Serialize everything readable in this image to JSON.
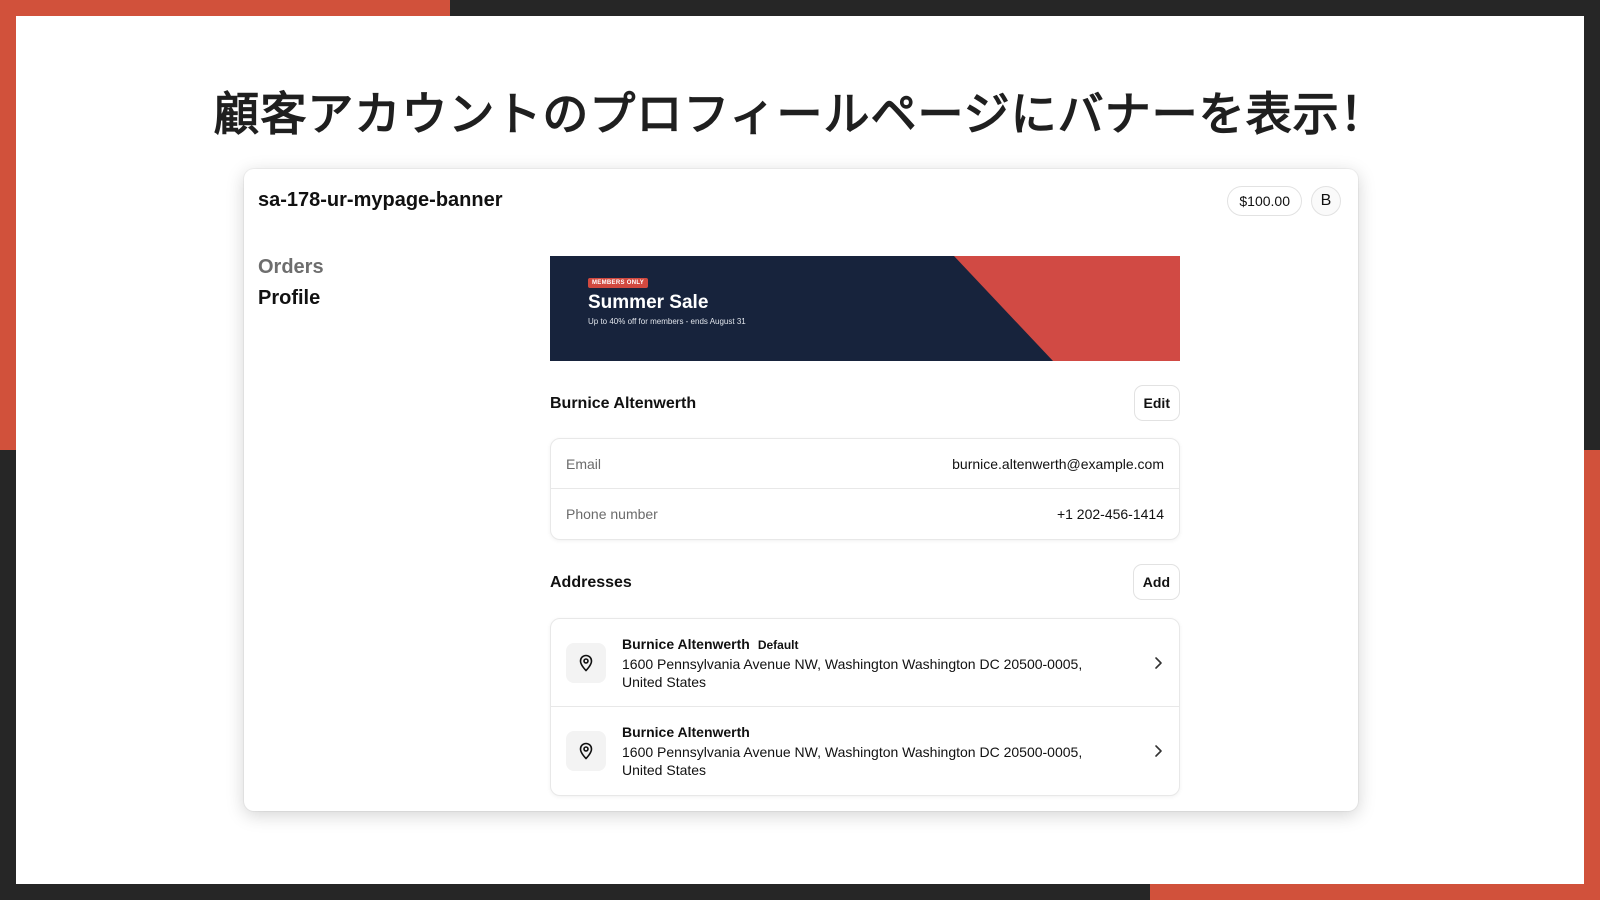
{
  "slide": {
    "title": "顧客アカウントのプロフィールページにバナーを表示！"
  },
  "app": {
    "store_name": "sa-178-ur-mypage-banner",
    "balance": "$100.00",
    "avatar_initial": "B"
  },
  "sidebar": {
    "items": [
      {
        "label": "Orders",
        "active": false
      },
      {
        "label": "Profile",
        "active": true
      }
    ]
  },
  "banner": {
    "badge": "MEMBERS ONLY",
    "title": "Summer Sale",
    "subtitle": "Up to 40% off for members - ends August 31",
    "colors": {
      "background": "#17233C",
      "accent": "#D14A44"
    }
  },
  "profile": {
    "name": "Burnice Altenwerth",
    "edit_label": "Edit",
    "fields": [
      {
        "label": "Email",
        "value": "burnice.altenwerth@example.com"
      },
      {
        "label": "Phone number",
        "value": "+1 202-456-1414"
      }
    ]
  },
  "addresses": {
    "title": "Addresses",
    "add_label": "Add",
    "items": [
      {
        "name": "Burnice Altenwerth",
        "badge": "Default",
        "line1": "1600 Pennsylvania Avenue NW, Washington Washington DC 20500-0005,",
        "line2": "United States"
      },
      {
        "name": "Burnice Altenwerth",
        "badge": "",
        "line1": "1600 Pennsylvania Avenue NW, Washington Washington DC 20500-0005,",
        "line2": "United States"
      }
    ]
  },
  "icons": {
    "address": "map-pin-icon",
    "row_action": "chevron-right-icon"
  },
  "theme": {
    "frame": "#262626",
    "accent": "#D1513B"
  }
}
